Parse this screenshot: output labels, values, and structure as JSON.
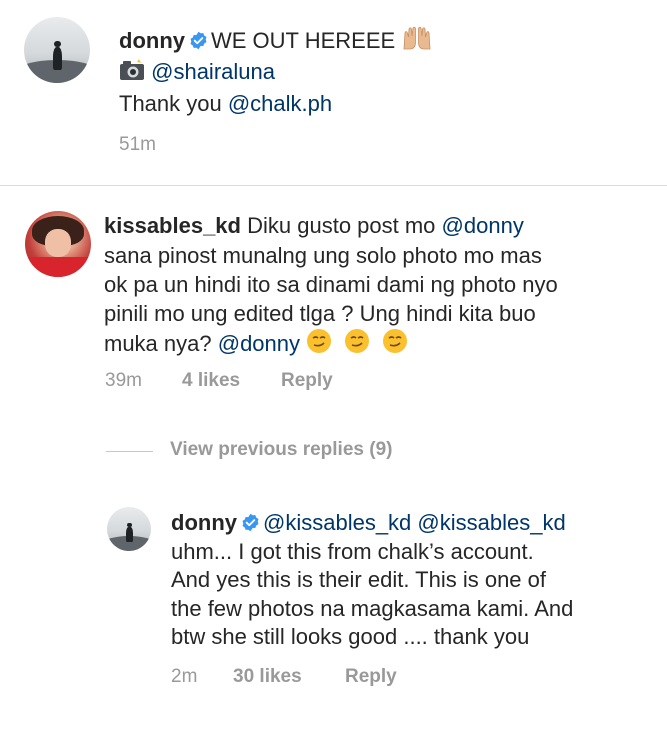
{
  "post": {
    "username": "donny",
    "caption_line1": "WE OUT HEREEE",
    "caption_line2_mention": "@shairaluna",
    "caption_line3_text": "Thank you ",
    "caption_line3_mention": "@chalk.ph",
    "time": "51m",
    "icons": [
      "verified-badge-icon",
      "raised-hands-emoji",
      "camera-flash-emoji"
    ]
  },
  "comment": {
    "username": "kissables_kd",
    "line1_text": "Diku gusto post mo ",
    "line1_mention": "@donny",
    "line2": "sana pinost munalng ung solo photo mo mas",
    "line3": "ok pa un hindi ito sa dinami dami ng photo nyo",
    "line4": "pinili mo ung edited tlga ? Ung hindi kita buo",
    "line5_text": "muka nya? ",
    "line5_mention": "@donny",
    "time": "39m",
    "likes": "4 likes",
    "reply": "Reply",
    "icons": [
      "smirking-face-emoji"
    ]
  },
  "view_previous_replies": "View previous replies (9)",
  "reply": {
    "username": "donny",
    "line1_mention1": "@kissables_kd",
    "line1_mention2": "@kissables_kd",
    "line2": "uhm... I got this from chalk’s account.",
    "line3": "And yes this is their edit. This is one of",
    "line4": "the few photos na magkasama kami. And",
    "line5": "btw she still looks good .... thank you",
    "time": "2m",
    "likes": "30 likes",
    "reply": "Reply"
  },
  "colors": {
    "text": "#262626",
    "mention": "#003569",
    "meta": "#999999",
    "verified": "#3897f0",
    "divider": "#dbdbdb"
  }
}
